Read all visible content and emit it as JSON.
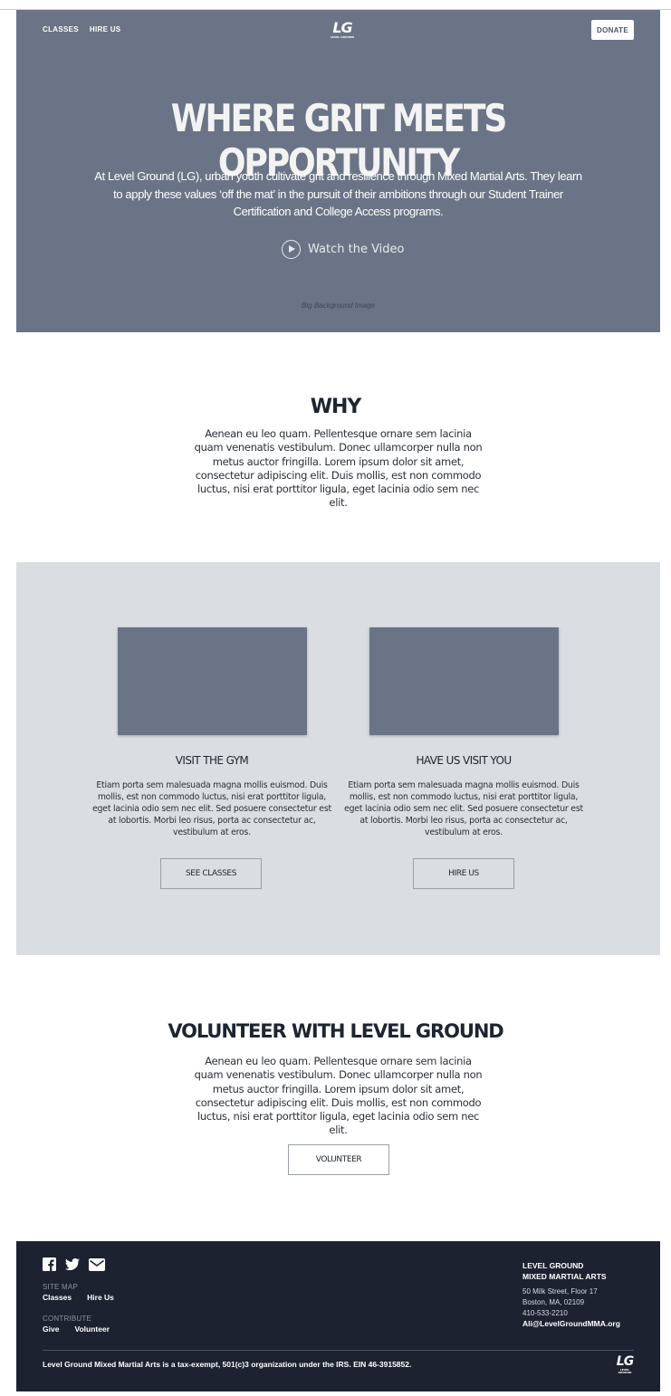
{
  "header": {
    "nav": [
      "CLASSES",
      "HIRE US"
    ],
    "logo_text": "LG",
    "logo_sub": "LEVEL GROUND",
    "donate_label": "DONATE"
  },
  "hero": {
    "title": "WHERE GRIT MEETS OPPORTUNITY",
    "description": "At Level Ground (LG), urban youth cultivate grit and resilience through Mixed Martial Arts. They learn to apply these values ‘off the mat’ in the pursuit of their ambitions through our Student Trainer Certification and College Access programs.",
    "video_label": "Watch the Video",
    "caption": "Big Background Image",
    "background_color": "#6a7486"
  },
  "why": {
    "title": "WHY",
    "text": "Aenean eu leo quam. Pellentesque ornare sem lacinia quam venenatis vestibulum. Donec ullamcorper nulla non metus auctor fringilla. Lorem ipsum dolor sit amet, consectetur adipiscing elit. Duis mollis, est non commodo luctus, nisi erat porttitor ligula, eget lacinia odio sem nec elit."
  },
  "services": {
    "background_color": "#dadde1",
    "cards": [
      {
        "title": "VISIT THE GYM",
        "text": "Etiam porta sem malesuada magna mollis euismod. Duis mollis, est non commodo luctus, nisi erat porttitor ligula, eget lacinia odio sem nec elit. Sed posuere consectetur est at lobortis. Morbi leo risus, porta ac consectetur ac, vestibulum at eros.",
        "button": "SEE CLASSES"
      },
      {
        "title": "HAVE US VISIT YOU",
        "text": "Etiam porta sem malesuada magna mollis euismod. Duis mollis, est non commodo luctus, nisi erat porttitor ligula, eget lacinia odio sem nec elit. Sed posuere consectetur est at lobortis. Morbi leo risus, porta ac consectetur ac, vestibulum at eros.",
        "button": "HIRE US"
      }
    ]
  },
  "volunteer": {
    "title": "VOLUNTEER WITH LEVEL GROUND",
    "text": "Aenean eu leo quam. Pellentesque ornare sem lacinia quam venenatis vestibulum. Donec ullamcorper nulla non metus auctor fringilla. Lorem ipsum dolor sit amet, consectetur adipiscing elit. Duis mollis, est non commodo luctus, nisi erat porttitor ligula, eget lacinia odio sem nec elit.",
    "button": "VOLUNTEER"
  },
  "footer": {
    "social_icons": [
      "facebook-icon",
      "twitter-icon",
      "email-icon"
    ],
    "sitemap_label": "SITE MAP",
    "sitemap_links": [
      "Classes",
      "Hire Us"
    ],
    "contribute_label": "CONTRIBUTE",
    "contribute_links": [
      "Give",
      "Volunteer"
    ],
    "org_name_1": "LEVEL GROUND",
    "org_name_2": "MIXED MARTIAL ARTS",
    "address_1": "50 Milk Street, Floor 17",
    "address_2": "Boston, MA, 02109",
    "phone": "410-533-2210",
    "email": "Ali@LevelGroundMMA.org",
    "legal": "Level Ground Mixed Martial Arts is a tax-exempt, 501(c)3 organization under the IRS. EIN 46-3915852.",
    "background_color": "#1c2230"
  }
}
